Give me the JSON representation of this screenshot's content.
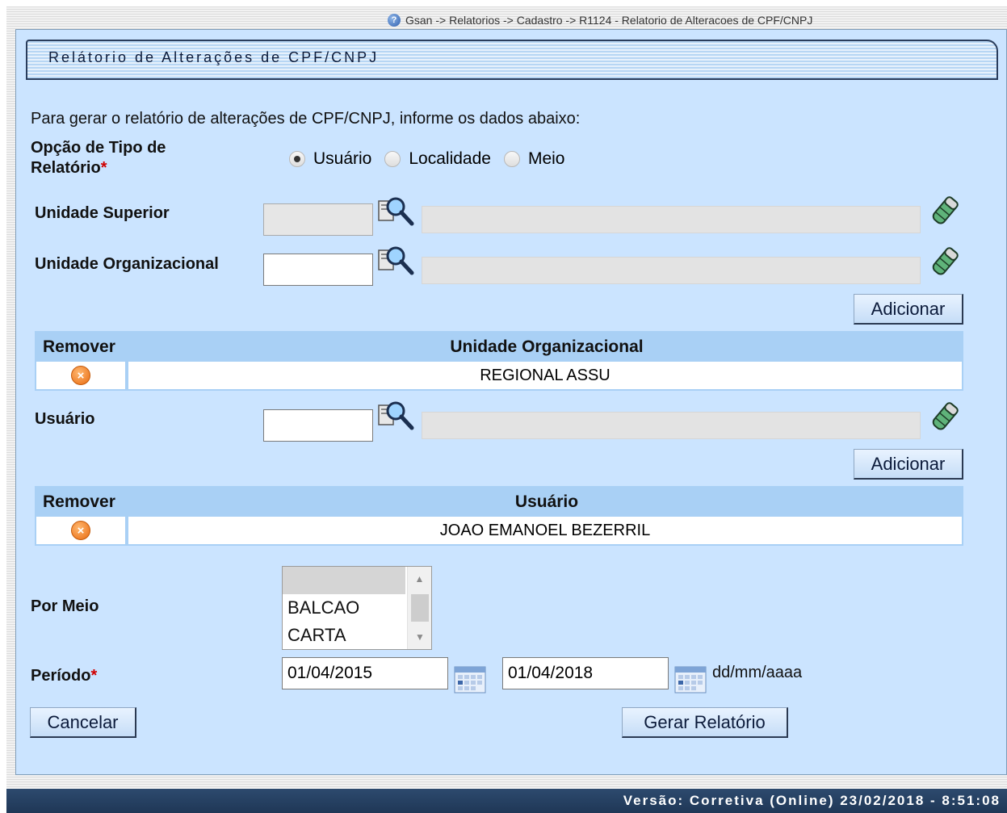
{
  "breadcrumb": "Gsan -> Relatorios -> Cadastro -> R1124 - Relatorio de Alteracoes de CPF/CNPJ",
  "title": "Relátorio de Alterações de CPF/CNPJ",
  "intro": "Para gerar o relatório de alterações de CPF/CNPJ, informe os dados abaixo:",
  "tipo": {
    "label_line1": "Opção de Tipo de",
    "label_line2": "Relatório",
    "required_mark": "*",
    "options": [
      "Usuário",
      "Localidade",
      "Meio"
    ],
    "selected": "Usuário"
  },
  "unidade_superior": {
    "label": "Unidade Superior",
    "value": "",
    "description": ""
  },
  "unidade_organizacional": {
    "label": "Unidade Organizacional",
    "value": "",
    "description": ""
  },
  "add_label": "Adicionar",
  "unidade_table": {
    "headers": [
      "Remover",
      "Unidade Organizacional"
    ],
    "rows": [
      {
        "name": "REGIONAL ASSU"
      }
    ]
  },
  "usuario": {
    "label": "Usuário",
    "value": "",
    "description": ""
  },
  "usuario_table": {
    "headers": [
      "Remover",
      "Usuário"
    ],
    "rows": [
      {
        "name": "JOAO EMANOEL BEZERRIL"
      }
    ]
  },
  "por_meio": {
    "label": "Por Meio",
    "options": [
      "",
      "BALCAO",
      "CARTA"
    ]
  },
  "periodo": {
    "label": "Período",
    "required_mark": "*",
    "start": "01/04/2015",
    "end": "01/04/2018",
    "format_hint": "dd/mm/aaaa"
  },
  "buttons": {
    "cancel": "Cancelar",
    "generate": "Gerar Relatório"
  },
  "footer": "Versão: Corretiva (Online) 23/02/2018 - 8:51:08",
  "colors": {
    "panel": "#cbe4ff",
    "table_header": "#a9d0f5",
    "footer": "#1f3756",
    "required": "#d00000"
  }
}
